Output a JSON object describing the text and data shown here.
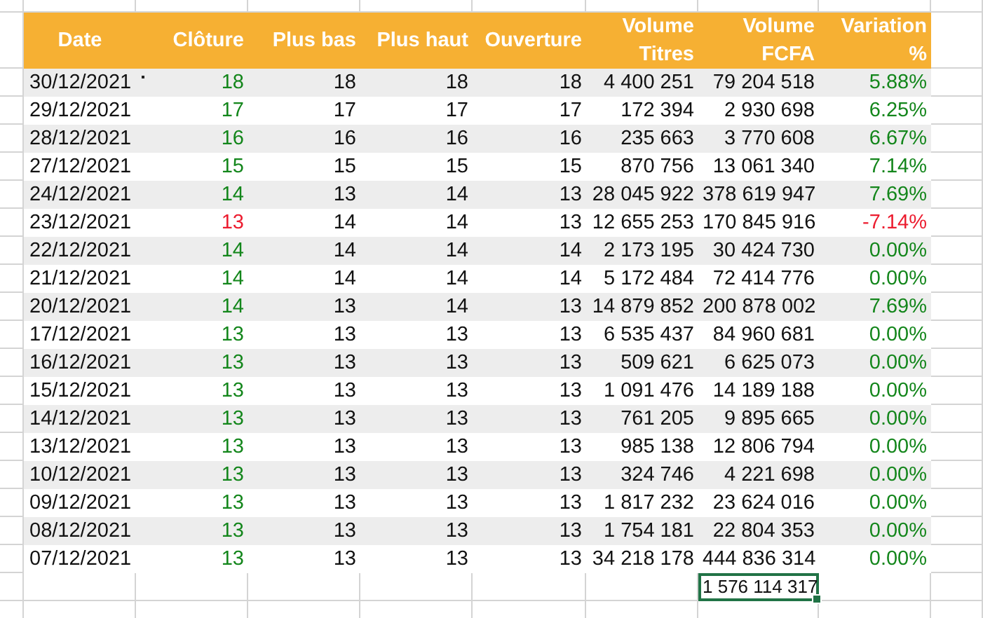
{
  "table": {
    "columns": [
      {
        "label": "Date"
      },
      {
        "label": "Clôture"
      },
      {
        "label": "Plus bas"
      },
      {
        "label": "Plus haut"
      },
      {
        "label": "Ouverture"
      },
      {
        "label": "Volume\nTitres"
      },
      {
        "label": "Volume\nFCFA"
      },
      {
        "label": "Variation\n%"
      }
    ],
    "rows": [
      {
        "date": "30/12/2021",
        "commented": true,
        "close": "18",
        "low": "18",
        "high": "18",
        "open": "18",
        "volume_titres": "4 400 251",
        "volume_fcfa": "79 204 518",
        "variation": "5.88%",
        "negative": false
      },
      {
        "date": "29/12/2021",
        "commented": false,
        "close": "17",
        "low": "17",
        "high": "17",
        "open": "17",
        "volume_titres": "172 394",
        "volume_fcfa": "2 930 698",
        "variation": "6.25%",
        "negative": false
      },
      {
        "date": "28/12/2021",
        "commented": false,
        "close": "16",
        "low": "16",
        "high": "16",
        "open": "16",
        "volume_titres": "235 663",
        "volume_fcfa": "3 770 608",
        "variation": "6.67%",
        "negative": false
      },
      {
        "date": "27/12/2021",
        "commented": false,
        "close": "15",
        "low": "15",
        "high": "15",
        "open": "15",
        "volume_titres": "870 756",
        "volume_fcfa": "13 061 340",
        "variation": "7.14%",
        "negative": false
      },
      {
        "date": "24/12/2021",
        "commented": false,
        "close": "14",
        "low": "13",
        "high": "14",
        "open": "13",
        "volume_titres": "28 045 922",
        "volume_fcfa": "378 619 947",
        "variation": "7.69%",
        "negative": false
      },
      {
        "date": "23/12/2021",
        "commented": false,
        "close": "13",
        "low": "14",
        "high": "14",
        "open": "13",
        "volume_titres": "12 655 253",
        "volume_fcfa": "170 845 916",
        "variation": "-7.14%",
        "negative": true
      },
      {
        "date": "22/12/2021",
        "commented": false,
        "close": "14",
        "low": "14",
        "high": "14",
        "open": "14",
        "volume_titres": "2 173 195",
        "volume_fcfa": "30 424 730",
        "variation": "0.00%",
        "negative": false
      },
      {
        "date": "21/12/2021",
        "commented": false,
        "close": "14",
        "low": "14",
        "high": "14",
        "open": "14",
        "volume_titres": "5 172 484",
        "volume_fcfa": "72 414 776",
        "variation": "0.00%",
        "negative": false
      },
      {
        "date": "20/12/2021",
        "commented": false,
        "close": "14",
        "low": "13",
        "high": "14",
        "open": "13",
        "volume_titres": "14 879 852",
        "volume_fcfa": "200 878 002",
        "variation": "7.69%",
        "negative": false
      },
      {
        "date": "17/12/2021",
        "commented": false,
        "close": "13",
        "low": "13",
        "high": "13",
        "open": "13",
        "volume_titres": "6 535 437",
        "volume_fcfa": "84 960 681",
        "variation": "0.00%",
        "negative": false
      },
      {
        "date": "16/12/2021",
        "commented": false,
        "close": "13",
        "low": "13",
        "high": "13",
        "open": "13",
        "volume_titres": "509 621",
        "volume_fcfa": "6 625 073",
        "variation": "0.00%",
        "negative": false
      },
      {
        "date": "15/12/2021",
        "commented": false,
        "close": "13",
        "low": "13",
        "high": "13",
        "open": "13",
        "volume_titres": "1 091 476",
        "volume_fcfa": "14 189 188",
        "variation": "0.00%",
        "negative": false
      },
      {
        "date": "14/12/2021",
        "commented": false,
        "close": "13",
        "low": "13",
        "high": "13",
        "open": "13",
        "volume_titres": "761 205",
        "volume_fcfa": "9 895 665",
        "variation": "0.00%",
        "negative": false
      },
      {
        "date": "13/12/2021",
        "commented": false,
        "close": "13",
        "low": "13",
        "high": "13",
        "open": "13",
        "volume_titres": "985 138",
        "volume_fcfa": "12 806 794",
        "variation": "0.00%",
        "negative": false
      },
      {
        "date": "10/12/2021",
        "commented": false,
        "close": "13",
        "low": "13",
        "high": "13",
        "open": "13",
        "volume_titres": "324 746",
        "volume_fcfa": "4 221 698",
        "variation": "0.00%",
        "negative": false
      },
      {
        "date": "09/12/2021",
        "commented": false,
        "close": "13",
        "low": "13",
        "high": "13",
        "open": "13",
        "volume_titres": "1 817 232",
        "volume_fcfa": "23 624 016",
        "variation": "0.00%",
        "negative": false
      },
      {
        "date": "08/12/2021",
        "commented": false,
        "close": "13",
        "low": "13",
        "high": "13",
        "open": "13",
        "volume_titres": "1 754 181",
        "volume_fcfa": "22 804 353",
        "variation": "0.00%",
        "negative": false
      },
      {
        "date": "07/12/2021",
        "commented": false,
        "close": "13",
        "low": "13",
        "high": "13",
        "open": "13",
        "volume_titres": "34 218 178",
        "volume_fcfa": "444 836 314",
        "variation": "0.00%",
        "negative": false
      }
    ]
  },
  "total": {
    "value": "1 576 114 317",
    "selected": true
  }
}
